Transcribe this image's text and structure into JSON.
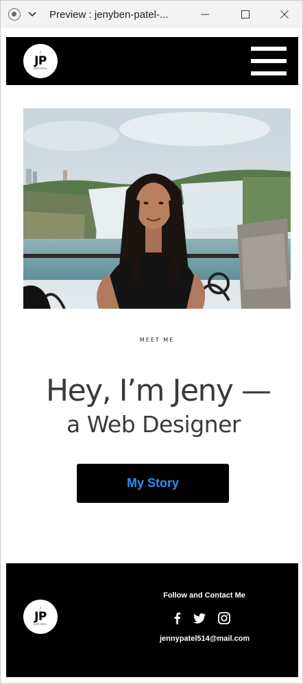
{
  "window": {
    "title": "Preview : jenyben-patel-..."
  },
  "header": {
    "logo": {
      "top": "♪",
      "main": "JP",
      "sub": "JENY PATEL"
    }
  },
  "hero": {
    "photo_alt": "Portrait of Jeny in front of a waterfall",
    "eyebrow": "MEET ME",
    "headline_line1": "Hey, I’m Jeny —",
    "headline_line2": "a Web Designer",
    "cta_label": "My Story"
  },
  "footer": {
    "logo": {
      "top": "♪",
      "main": "JP",
      "sub": "JENY PATEL"
    },
    "follow_title": "Follow and Contact Me",
    "social": [
      "facebook-icon",
      "twitter-icon",
      "instagram-icon"
    ],
    "email": "jennypatel514@mail.com"
  },
  "colors": {
    "header_bg": "#000000",
    "cta_text": "#2c8ef0",
    "headline": "#3a3a3a"
  }
}
